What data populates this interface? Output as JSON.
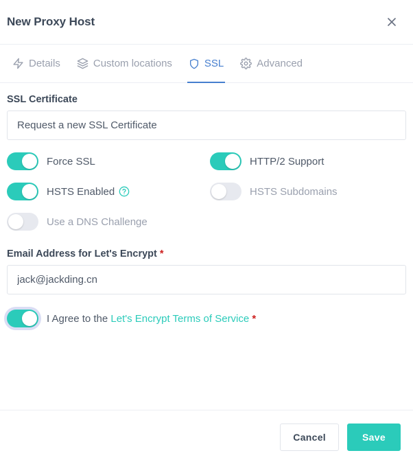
{
  "modal": {
    "title": "New Proxy Host",
    "close_icon": "close-icon"
  },
  "tabs": [
    {
      "label": "Details",
      "icon": "bolt-icon",
      "active": false
    },
    {
      "label": "Custom locations",
      "icon": "layers-icon",
      "active": false
    },
    {
      "label": "SSL",
      "icon": "shield-icon",
      "active": true
    },
    {
      "label": "Advanced",
      "icon": "gear-icon",
      "active": false
    }
  ],
  "ssl_certificate": {
    "label": "SSL Certificate",
    "value": "Request a new SSL Certificate"
  },
  "toggles": {
    "force_ssl": {
      "label": "Force SSL",
      "on": true
    },
    "http2_support": {
      "label": "HTTP/2 Support",
      "on": true
    },
    "hsts_enabled": {
      "label": "HSTS Enabled",
      "on": true,
      "help_icon": "help-circle-icon"
    },
    "hsts_subdomains": {
      "label": "HSTS Subdomains",
      "on": false
    },
    "dns_challenge": {
      "label": "Use a DNS Challenge",
      "on": false
    }
  },
  "email": {
    "label": "Email Address for Let's Encrypt",
    "required_mark": "*",
    "value": "jack@jackding.cn",
    "placeholder": ""
  },
  "agree": {
    "on": true,
    "prefix": "I Agree to the",
    "link_text": "Let's Encrypt Terms of Service",
    "required_mark": "*"
  },
  "footer": {
    "cancel_label": "Cancel",
    "save_label": "Save"
  },
  "colors": {
    "accent_teal": "#2bcbba",
    "accent_blue": "#467fcf",
    "required_red": "#cd201f",
    "text_dark": "#3c4858",
    "text_muted": "#9aa0ae"
  }
}
